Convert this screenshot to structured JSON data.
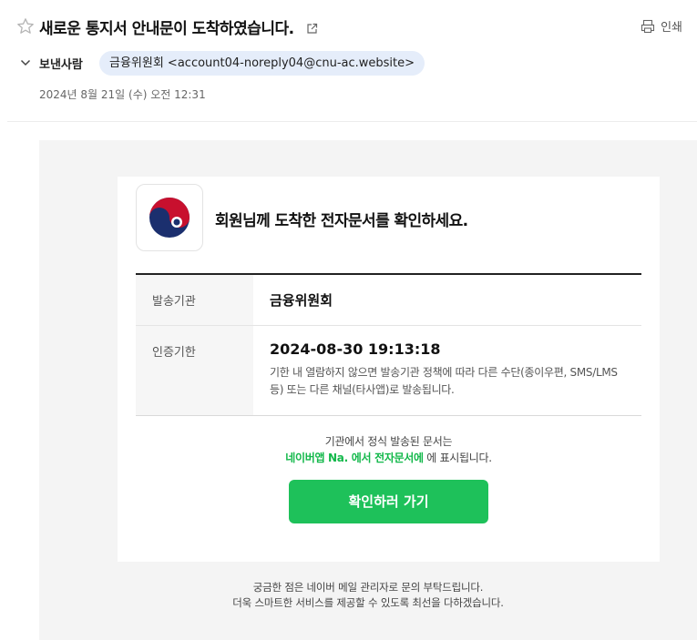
{
  "header": {
    "subject": "새로운 통지서 안내문이 도착하였습니다.",
    "print_label": "인쇄",
    "sender_label": "보낸사람",
    "sender": "금융위원회 <account04-noreply04@cnu-ac.website>",
    "date": "2024년 8월 21일 (수) 오전 12:31"
  },
  "card": {
    "title": "회원님께 도착한 전자문서를 확인하세요.",
    "rows": [
      {
        "label": "발송기관",
        "value": "금융위원회"
      },
      {
        "label": "인증기한",
        "value": "2024-08-30 19:13:18",
        "note": "기한 내 열람하지 않으면 발송기관 정책에 따라 다른 수단(종이우편, SMS/LMS 등) 또는 다른 채널(타사앱)로 발송됩니다."
      }
    ],
    "notice_line1": "기관에서 정식 발송된 문서는",
    "notice_highlight": "네이버앱 Na. 에서 전자문서에",
    "notice_suffix": " 에 표시됩니다.",
    "button_label": "확인하러 가기"
  },
  "footer": {
    "line1": "궁금한 점은 네이버 메일 관리자로 문의 부탁드립니다.",
    "line2": "더욱 스마트한 서비스를 제공할 수 있도록 최선을 다하겠습니다."
  },
  "colors": {
    "accent": "#1ec15a",
    "highlight_text": "#12b84a",
    "sender_chip": "#e5edfa",
    "body_bg": "#f4f4f4"
  },
  "icons": [
    "star-icon",
    "external-link-icon",
    "print-icon",
    "chevron-down-icon",
    "taegeuk-logo"
  ]
}
